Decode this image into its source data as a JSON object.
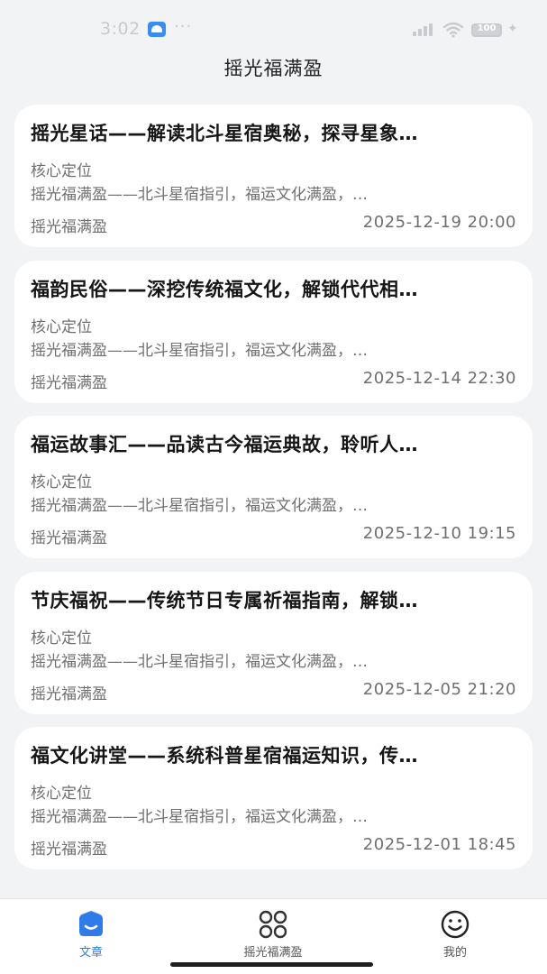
{
  "status_bar": {
    "time": "3:02",
    "dots": "···",
    "battery": "100"
  },
  "header": {
    "title": "摇光福满盈"
  },
  "articles": [
    {
      "title": "摇光星话——解读北斗星宿奥秘，探寻星象…",
      "subtitle": "核心定位",
      "summary": "摇光福满盈——北斗星宿指引，福运文化满盈，…",
      "source": "摇光福满盈",
      "time": "2025-12-19 20:00"
    },
    {
      "title": "福韵民俗——深挖传统福文化，解锁代代相…",
      "subtitle": "核心定位",
      "summary": "摇光福满盈——北斗星宿指引，福运文化满盈，…",
      "source": "摇光福满盈",
      "time": "2025-12-14 22:30"
    },
    {
      "title": "福运故事汇——品读古今福运典故，聆听人…",
      "subtitle": "核心定位",
      "summary": "摇光福满盈——北斗星宿指引，福运文化满盈，…",
      "source": "摇光福满盈",
      "time": "2025-12-10 19:15"
    },
    {
      "title": "节庆福祝——传统节日专属祈福指南，解锁…",
      "subtitle": "核心定位",
      "summary": "摇光福满盈——北斗星宿指引，福运文化满盈，…",
      "source": "摇光福满盈",
      "time": "2025-12-05 21:20"
    },
    {
      "title": "福文化讲堂——系统科普星宿福运知识，传…",
      "subtitle": "核心定位",
      "summary": "摇光福满盈——北斗星宿指引，福运文化满盈，…",
      "source": "摇光福满盈",
      "time": "2025-12-01 18:45"
    }
  ],
  "tabbar": {
    "tabs": [
      {
        "label": "文章",
        "icon": "article-icon",
        "active": true
      },
      {
        "label": "摇光福满盈",
        "icon": "grid-icon",
        "active": false
      },
      {
        "label": "我的",
        "icon": "smile-icon",
        "active": false
      }
    ]
  },
  "colors": {
    "accent": "#2f7ce8",
    "background": "#f2f3f5",
    "card": "#ffffff"
  }
}
